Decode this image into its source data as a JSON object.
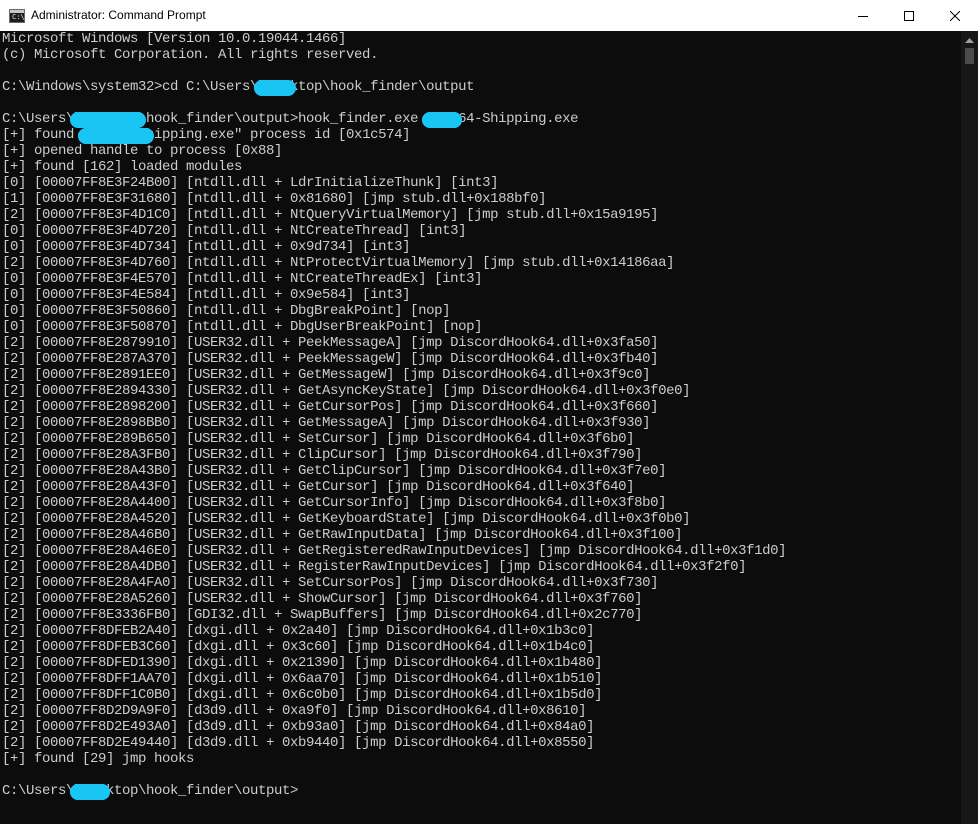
{
  "window": {
    "title": "Administrator: Command Prompt",
    "icon_label": "C:\\"
  },
  "console": {
    "lines": [
      {
        "text": "Microsoft Windows [Version 10.0.19044.1466]"
      },
      {
        "text": "(c) Microsoft Corporation. All rights reserved."
      },
      {
        "text": ""
      },
      {
        "parts": [
          "C:\\Windows\\system32>cd C:\\Users\\",
          "",
          "\\Desktop\\hook_finder\\output"
        ]
      },
      {
        "text": ""
      },
      {
        "parts": [
          "C:\\Users\\",
          "",
          "\\Desktop\\hook_finder\\output>hook_finder.exe ",
          "",
          "-Win64-Shipping.exe"
        ]
      },
      {
        "parts": [
          "[+] found ",
          "",
          "-Win64-Shipping.exe\" process id [0x1c574]"
        ]
      },
      {
        "text": "[+] opened handle to process [0x88]"
      },
      {
        "text": "[+] found [162] loaded modules"
      },
      {
        "text": "[0] [00007FF8E3F24B00] [ntdll.dll + LdrInitializeThunk] [int3]"
      },
      {
        "text": "[1] [00007FF8E3F31680] [ntdll.dll + 0x81680] [jmp stub.dll+0x188bf0]"
      },
      {
        "text": "[2] [00007FF8E3F4D1C0] [ntdll.dll + NtQueryVirtualMemory] [jmp stub.dll+0x15a9195]"
      },
      {
        "text": "[0] [00007FF8E3F4D720] [ntdll.dll + NtCreateThread] [int3]"
      },
      {
        "text": "[0] [00007FF8E3F4D734] [ntdll.dll + 0x9d734] [int3]"
      },
      {
        "text": "[2] [00007FF8E3F4D760] [ntdll.dll + NtProtectVirtualMemory] [jmp stub.dll+0x14186aa]"
      },
      {
        "text": "[0] [00007FF8E3F4E570] [ntdll.dll + NtCreateThreadEx] [int3]"
      },
      {
        "text": "[0] [00007FF8E3F4E584] [ntdll.dll + 0x9e584] [int3]"
      },
      {
        "text": "[0] [00007FF8E3F50860] [ntdll.dll + DbgBreakPoint] [nop]"
      },
      {
        "text": "[0] [00007FF8E3F50870] [ntdll.dll + DbgUserBreakPoint] [nop]"
      },
      {
        "text": "[2] [00007FF8E2879910] [USER32.dll + PeekMessageA] [jmp DiscordHook64.dll+0x3fa50]"
      },
      {
        "text": "[2] [00007FF8E287A370] [USER32.dll + PeekMessageW] [jmp DiscordHook64.dll+0x3fb40]"
      },
      {
        "text": "[2] [00007FF8E2891EE0] [USER32.dll + GetMessageW] [jmp DiscordHook64.dll+0x3f9c0]"
      },
      {
        "text": "[2] [00007FF8E2894330] [USER32.dll + GetAsyncKeyState] [jmp DiscordHook64.dll+0x3f0e0]"
      },
      {
        "text": "[2] [00007FF8E2898200] [USER32.dll + GetCursorPos] [jmp DiscordHook64.dll+0x3f660]"
      },
      {
        "text": "[2] [00007FF8E2898BB0] [USER32.dll + GetMessageA] [jmp DiscordHook64.dll+0x3f930]"
      },
      {
        "text": "[2] [00007FF8E289B650] [USER32.dll + SetCursor] [jmp DiscordHook64.dll+0x3f6b0]"
      },
      {
        "text": "[2] [00007FF8E28A3FB0] [USER32.dll + ClipCursor] [jmp DiscordHook64.dll+0x3f790]"
      },
      {
        "text": "[2] [00007FF8E28A43B0] [USER32.dll + GetClipCursor] [jmp DiscordHook64.dll+0x3f7e0]"
      },
      {
        "text": "[2] [00007FF8E28A43F0] [USER32.dll + GetCursor] [jmp DiscordHook64.dll+0x3f640]"
      },
      {
        "text": "[2] [00007FF8E28A4400] [USER32.dll + GetCursorInfo] [jmp DiscordHook64.dll+0x3f8b0]"
      },
      {
        "text": "[2] [00007FF8E28A4520] [USER32.dll + GetKeyboardState] [jmp DiscordHook64.dll+0x3f0b0]"
      },
      {
        "text": "[2] [00007FF8E28A46B0] [USER32.dll + GetRawInputData] [jmp DiscordHook64.dll+0x3f100]"
      },
      {
        "text": "[2] [00007FF8E28A46E0] [USER32.dll + GetRegisteredRawInputDevices] [jmp DiscordHook64.dll+0x3f1d0]"
      },
      {
        "text": "[2] [00007FF8E28A4DB0] [USER32.dll + RegisterRawInputDevices] [jmp DiscordHook64.dll+0x3f2f0]"
      },
      {
        "text": "[2] [00007FF8E28A4FA0] [USER32.dll + SetCursorPos] [jmp DiscordHook64.dll+0x3f730]"
      },
      {
        "text": "[2] [00007FF8E28A5260] [USER32.dll + ShowCursor] [jmp DiscordHook64.dll+0x3f760]"
      },
      {
        "text": "[2] [00007FF8E3336FB0] [GDI32.dll + SwapBuffers] [jmp DiscordHook64.dll+0x2c770]"
      },
      {
        "text": "[2] [00007FF8DFEB2A40] [dxgi.dll + 0x2a40] [jmp DiscordHook64.dll+0x1b3c0]"
      },
      {
        "text": "[2] [00007FF8DFEB3C60] [dxgi.dll + 0x3c60] [jmp DiscordHook64.dll+0x1b4c0]"
      },
      {
        "text": "[2] [00007FF8DFED1390] [dxgi.dll + 0x21390] [jmp DiscordHook64.dll+0x1b480]"
      },
      {
        "text": "[2] [00007FF8DFF1AA70] [dxgi.dll + 0x6aa70] [jmp DiscordHook64.dll+0x1b510]"
      },
      {
        "text": "[2] [00007FF8DFF1C0B0] [dxgi.dll + 0x6c0b0] [jmp DiscordHook64.dll+0x1b5d0]"
      },
      {
        "text": "[2] [00007FF8D2D9A9F0] [d3d9.dll + 0xa9f0] [jmp DiscordHook64.dll+0x8610]"
      },
      {
        "text": "[2] [00007FF8D2E493A0] [d3d9.dll + 0xb93a0] [jmp DiscordHook64.dll+0x84a0]"
      },
      {
        "text": "[2] [00007FF8D2E49440] [d3d9.dll + 0xb9440] [jmp DiscordHook64.dll+0x8550]"
      },
      {
        "text": "[+] found [29] jmp hooks"
      },
      {
        "text": ""
      },
      {
        "parts": [
          "C:\\Users\\",
          "",
          "\\Desktop\\hook_finder\\output>"
        ]
      }
    ]
  },
  "colors": {
    "console_bg": "#0c0c0c",
    "console_text": "#cccccc",
    "titlebar_bg": "#ffffff",
    "redaction": "#19c5f2"
  }
}
